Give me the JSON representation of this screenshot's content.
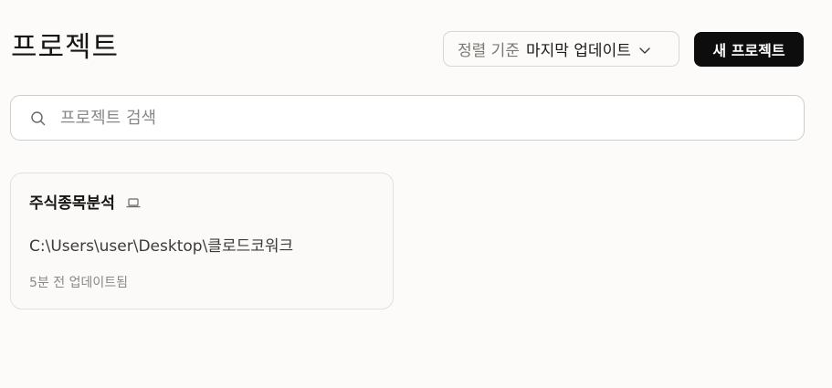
{
  "header": {
    "title": "프로젝트",
    "sort": {
      "prefix": "정렬 기준",
      "value": "마지막 업데이트"
    },
    "new_project_label": "새 프로젝트"
  },
  "search": {
    "placeholder": "프로젝트 검색",
    "value": ""
  },
  "projects": [
    {
      "name": "주식종목분석",
      "path": "C:\\Users\\user\\Desktop\\클로드코워크",
      "updated": "5분 전 업데이트됨",
      "icon": "laptop-icon"
    }
  ],
  "colors": {
    "background": "#fcfbf9",
    "primary_button": "#0d0d0d",
    "border": "#cfcdc9",
    "muted_text": "#8a8884"
  }
}
